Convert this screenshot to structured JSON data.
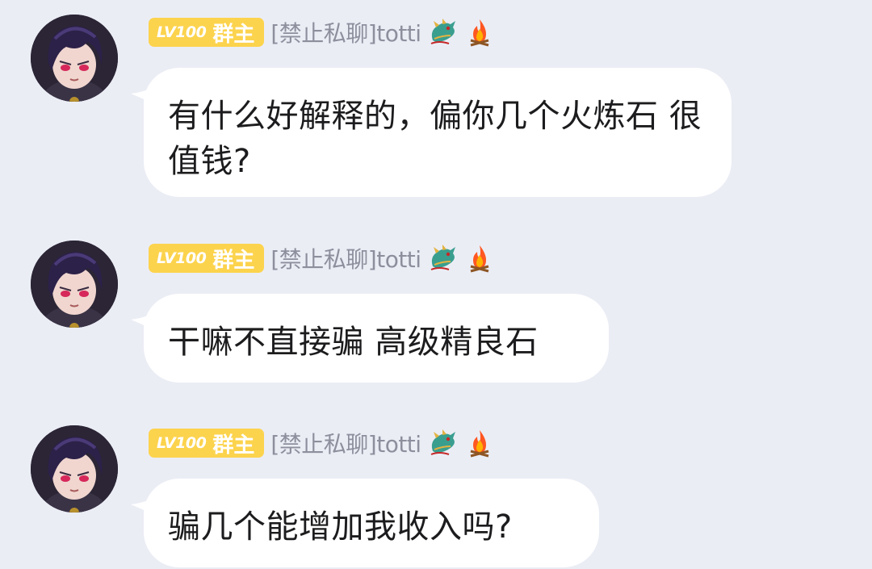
{
  "messages": [
    {
      "level": "LV100",
      "role": "群主",
      "name": "[禁止私聊]totti",
      "icons": [
        "dragon-badge-icon",
        "fire-icon"
      ],
      "text": "有什么好解释的，偏你几个火炼石 很值钱?"
    },
    {
      "level": "LV100",
      "role": "群主",
      "name": "[禁止私聊]totti",
      "icons": [
        "dragon-badge-icon",
        "fire-icon"
      ],
      "text": "干嘛不直接骗 高级精良石"
    },
    {
      "level": "LV100",
      "role": "群主",
      "name": "[禁止私聊]totti",
      "icons": [
        "dragon-badge-icon",
        "fire-icon"
      ],
      "text": "骗几个能增加我收入吗?"
    }
  ],
  "colors": {
    "background": "#ebedf5",
    "bubble": "#ffffff",
    "badge": "#fcd34d",
    "name": "#8d8f9d",
    "text": "#1c1c1e"
  }
}
